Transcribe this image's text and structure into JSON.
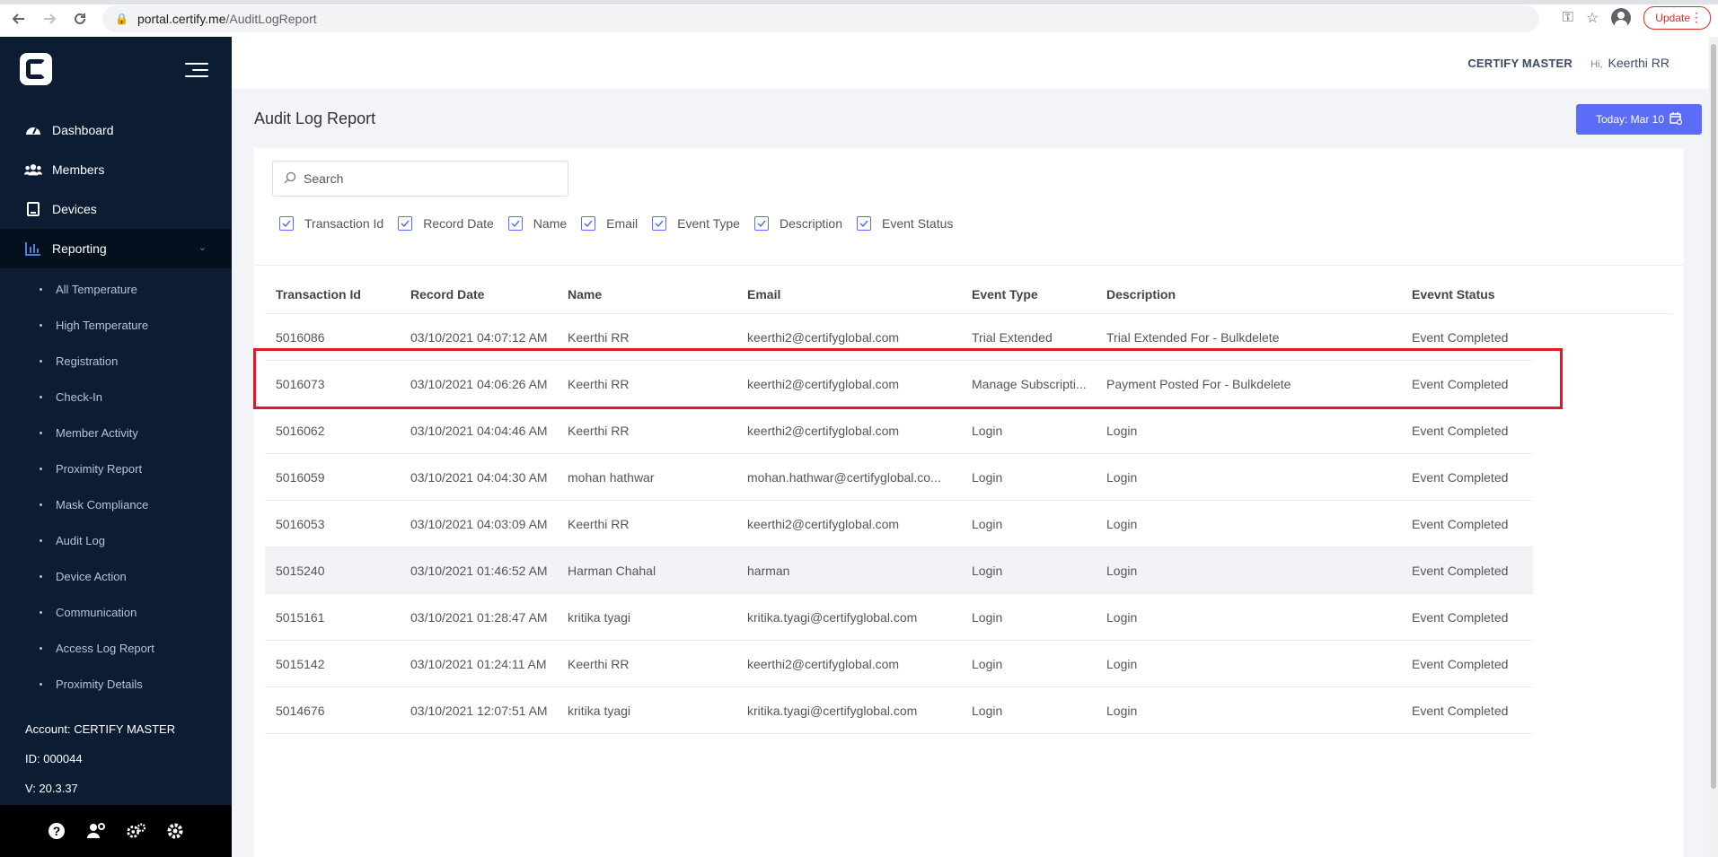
{
  "browser": {
    "url_host": "portal.certify.me",
    "url_path": "/AuditLogReport",
    "update_label": "Update"
  },
  "sidebar": {
    "nav": [
      {
        "label": "Dashboard",
        "icon": "dashboard-gauge-icon"
      },
      {
        "label": "Members",
        "icon": "users-icon"
      },
      {
        "label": "Devices",
        "icon": "tablet-icon"
      },
      {
        "label": "Reporting",
        "icon": "bar-chart-icon",
        "active": true
      }
    ],
    "reporting_items": [
      "All Temperature",
      "High Temperature",
      "Registration",
      "Check-In",
      "Member Activity",
      "Proximity Report",
      "Mask Compliance",
      "Audit Log",
      "Device Action",
      "Communication",
      "Access Log Report",
      "Proximity Details"
    ],
    "account": "Account: CERTIFY MASTER",
    "id": "ID: 000044",
    "version": "V: 20.3.37",
    "footer_icons": [
      "help-icon",
      "user-settings-icon",
      "gears-icon",
      "settings-icon"
    ]
  },
  "header": {
    "account_name": "CERTIFY MASTER",
    "hi": "Hi,",
    "user_name": "Keerthi RR"
  },
  "page": {
    "title": "Audit Log Report",
    "date_button": "Today: Mar 10"
  },
  "search": {
    "placeholder": "Search"
  },
  "filters": [
    "Transaction Id",
    "Record Date",
    "Name",
    "Email",
    "Event Type",
    "Description",
    "Event Status"
  ],
  "table": {
    "columns": [
      "Transaction Id",
      "Record Date",
      "Name",
      "Email",
      "Event Type",
      "Description",
      "Evevnt Status"
    ],
    "rows": [
      [
        "5016086",
        "03/10/2021 04:07:12 AM",
        "Keerthi RR",
        "keerthi2@certifyglobal.com",
        "Trial Extended",
        "Trial Extended For - Bulkdelete",
        "Event Completed"
      ],
      [
        "5016073",
        "03/10/2021 04:06:26 AM",
        "Keerthi RR",
        "keerthi2@certifyglobal.com",
        "Manage Subscripti...",
        "Payment Posted For - Bulkdelete",
        "Event Completed"
      ],
      [
        "5016062",
        "03/10/2021 04:04:46 AM",
        "Keerthi RR",
        "keerthi2@certifyglobal.com",
        "Login",
        "Login",
        "Event Completed"
      ],
      [
        "5016059",
        "03/10/2021 04:04:30 AM",
        "mohan hathwar",
        "mohan.hathwar@certifyglobal.co...",
        "Login",
        "Login",
        "Event Completed"
      ],
      [
        "5016053",
        "03/10/2021 04:03:09 AM",
        "Keerthi RR",
        "keerthi2@certifyglobal.com",
        "Login",
        "Login",
        "Event Completed"
      ],
      [
        "5015240",
        "03/10/2021 01:46:52 AM",
        "Harman Chahal",
        "harman",
        "Login",
        "Login",
        "Event Completed"
      ],
      [
        "5015161",
        "03/10/2021 01:28:47 AM",
        "kritika tyagi",
        "kritika.tyagi@certifyglobal.com",
        "Login",
        "Login",
        "Event Completed"
      ],
      [
        "5015142",
        "03/10/2021 01:24:11 AM",
        "Keerthi RR",
        "keerthi2@certifyglobal.com",
        "Login",
        "Login",
        "Event Completed"
      ],
      [
        "5014676",
        "03/10/2021 12:07:51 AM",
        "kritika tyagi",
        "kritika.tyagi@certifyglobal.com",
        "Login",
        "Login",
        "Event Completed"
      ]
    ]
  },
  "colors": {
    "sidebar_bg": "#0c1d33",
    "accent": "#5b6df8",
    "highlight_box": "#e0192a"
  }
}
